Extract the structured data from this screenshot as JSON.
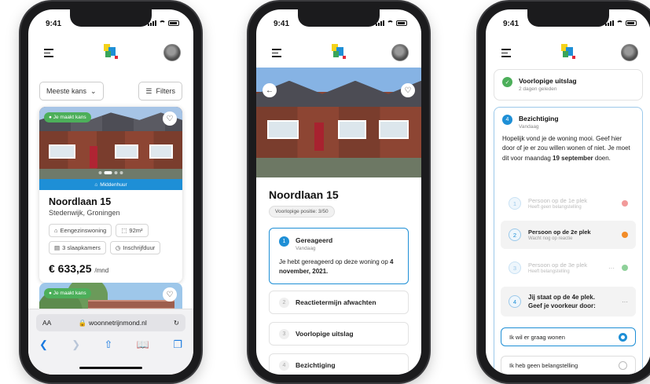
{
  "colors": {
    "accent": "#1e8fd6",
    "success": "#4caf5a",
    "warning": "#f28c28",
    "danger": "#e85a5a",
    "door_red": "#b02433"
  },
  "status_bar": {
    "time": "9:41"
  },
  "phone1": {
    "sort_label": "Meeste kans",
    "filters_label": "Filters",
    "card": {
      "badge": "Je maakt kans",
      "band": "Middenhuur",
      "title": "Noordlaan 15",
      "location": "Stedenwijk, Groningen",
      "features": [
        "Eengezinswoning",
        "92m²",
        "3 slaapkamers",
        "Inschrijfduur"
      ],
      "price": "€ 633,25",
      "price_unit": "/mnd"
    },
    "card2_badge": "Je maakt kans",
    "browser": {
      "text_size": "AA",
      "url": "woonnetrijnmond.nl"
    }
  },
  "phone2": {
    "title": "Noordlaan 15",
    "position_pill": "Voorlopige positie: 3/50",
    "steps": [
      {
        "num": "1",
        "title": "Gereageerd",
        "sub": "Vandaag",
        "text_pre": "Je hebt gereageerd op deze woning op ",
        "text_bold": "4 november, 2021."
      },
      {
        "num": "2",
        "title": "Reactietermijn afwachten"
      },
      {
        "num": "3",
        "title": "Voorlopige uitslag"
      },
      {
        "num": "4",
        "title": "Bezichtiging"
      }
    ]
  },
  "phone3": {
    "prev_step": {
      "title": "Voorlopige uitslag",
      "sub": "2 dagen geleden"
    },
    "current_step": {
      "num": "4",
      "title": "Bezichtiging",
      "sub": "Vandaag",
      "text_pre": "Hopelijk vond je de woning mooi. Geef hier door of je er zou willen wonen of niet. Je moet dit voor maandag ",
      "text_bold": "19 september",
      "text_post": " doen."
    },
    "people": [
      {
        "num": "1",
        "title": "Persoon op de 1e plek",
        "sub": "Heeft geen belangstelling"
      },
      {
        "num": "2",
        "title": "Persoon op de 2e plek",
        "sub": "Wacht nog op reactie"
      },
      {
        "num": "3",
        "title": "Persoon op de 3e plek",
        "sub": "Heeft belangstelling"
      },
      {
        "num": "4",
        "title": "Jij staat op de 4e plek.",
        "sub": "Geef je voorkeur door:"
      }
    ],
    "options": [
      "Ik wil er graag wonen",
      "Ik heb geen belangstelling"
    ]
  }
}
